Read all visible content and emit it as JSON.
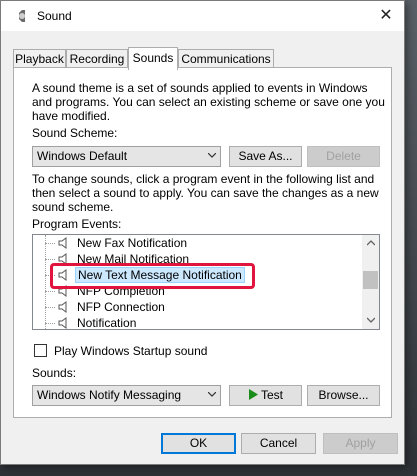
{
  "window": {
    "title": "Sound",
    "close_glyph": "✕"
  },
  "tabs": [
    {
      "label": "Playback"
    },
    {
      "label": "Recording"
    },
    {
      "label": "Sounds",
      "active": true
    },
    {
      "label": "Communications"
    }
  ],
  "sounds_tab": {
    "intro_lines": [
      "A sound theme is a set of sounds applied to events in Windows",
      "and programs.  You can select an existing scheme or save one you",
      "have modified."
    ],
    "scheme_label": "Sound Scheme:",
    "scheme_value": "Windows Default",
    "save_as_label": "Save As...",
    "delete_label": "Delete",
    "instructions_lines": [
      "To change sounds, click a program event in the following list and",
      "then select a sound to apply.  You can save the changes as a new",
      "sound scheme."
    ],
    "program_events_label": "Program Events:",
    "events": [
      {
        "label": "New Fax Notification"
      },
      {
        "label": "New Mail Notification"
      },
      {
        "label": "New Text Message Notification",
        "selected": true
      },
      {
        "label": "NFP Completion"
      },
      {
        "label": "NFP Connection"
      },
      {
        "label": "Notification"
      }
    ],
    "startup_checkbox_label": "Play Windows Startup sound",
    "startup_checked": false,
    "sounds_label": "Sounds:",
    "sounds_value": "Windows Notify Messaging",
    "test_label": "Test",
    "browse_label": "Browse..."
  },
  "footer": {
    "ok_label": "OK",
    "cancel_label": "Cancel",
    "apply_label": "Apply"
  },
  "colors": {
    "highlight_border": "#e0143c",
    "selection_bg": "#cce8ff",
    "accent": "#0078d7"
  },
  "icons": {
    "app": "speaker-app-icon",
    "event": "speaker-icon",
    "test": "play-triangle-icon"
  }
}
